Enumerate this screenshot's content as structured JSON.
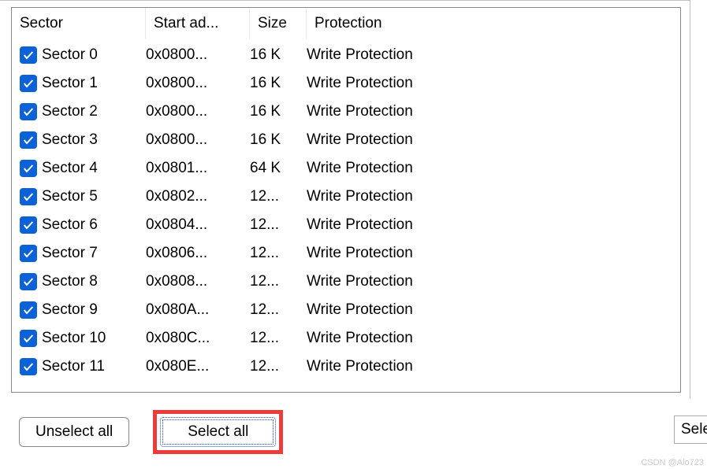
{
  "columns": {
    "sector": "Sector",
    "start_addr": "Start ad...",
    "size": "Size",
    "protection": "Protection"
  },
  "rows": [
    {
      "checked": true,
      "name": "Sector 0",
      "addr": "0x0800...",
      "size": "16 K",
      "prot": "Write Protection"
    },
    {
      "checked": true,
      "name": "Sector 1",
      "addr": "0x0800...",
      "size": "16 K",
      "prot": "Write Protection"
    },
    {
      "checked": true,
      "name": "Sector 2",
      "addr": "0x0800...",
      "size": "16 K",
      "prot": "Write Protection"
    },
    {
      "checked": true,
      "name": "Sector 3",
      "addr": "0x0800...",
      "size": "16 K",
      "prot": "Write Protection"
    },
    {
      "checked": true,
      "name": "Sector 4",
      "addr": "0x0801...",
      "size": "64 K",
      "prot": "Write Protection"
    },
    {
      "checked": true,
      "name": "Sector 5",
      "addr": "0x0802...",
      "size": "12...",
      "prot": "Write Protection"
    },
    {
      "checked": true,
      "name": "Sector 6",
      "addr": "0x0804...",
      "size": "12...",
      "prot": "Write Protection"
    },
    {
      "checked": true,
      "name": "Sector 7",
      "addr": "0x0806...",
      "size": "12...",
      "prot": "Write Protection"
    },
    {
      "checked": true,
      "name": "Sector 8",
      "addr": "0x0808...",
      "size": "12...",
      "prot": "Write Protection"
    },
    {
      "checked": true,
      "name": "Sector 9",
      "addr": "0x080A...",
      "size": "12...",
      "prot": "Write Protection"
    },
    {
      "checked": true,
      "name": "Sector 10",
      "addr": "0x080C...",
      "size": "12...",
      "prot": "Write Protection"
    },
    {
      "checked": true,
      "name": "Sector 11",
      "addr": "0x080E...",
      "size": "12...",
      "prot": "Write Protection"
    }
  ],
  "buttons": {
    "unselect_all": "Unselect all",
    "select_all": "Select all"
  },
  "side_fragment": "Sele",
  "watermark": "CSDN @Alo723"
}
